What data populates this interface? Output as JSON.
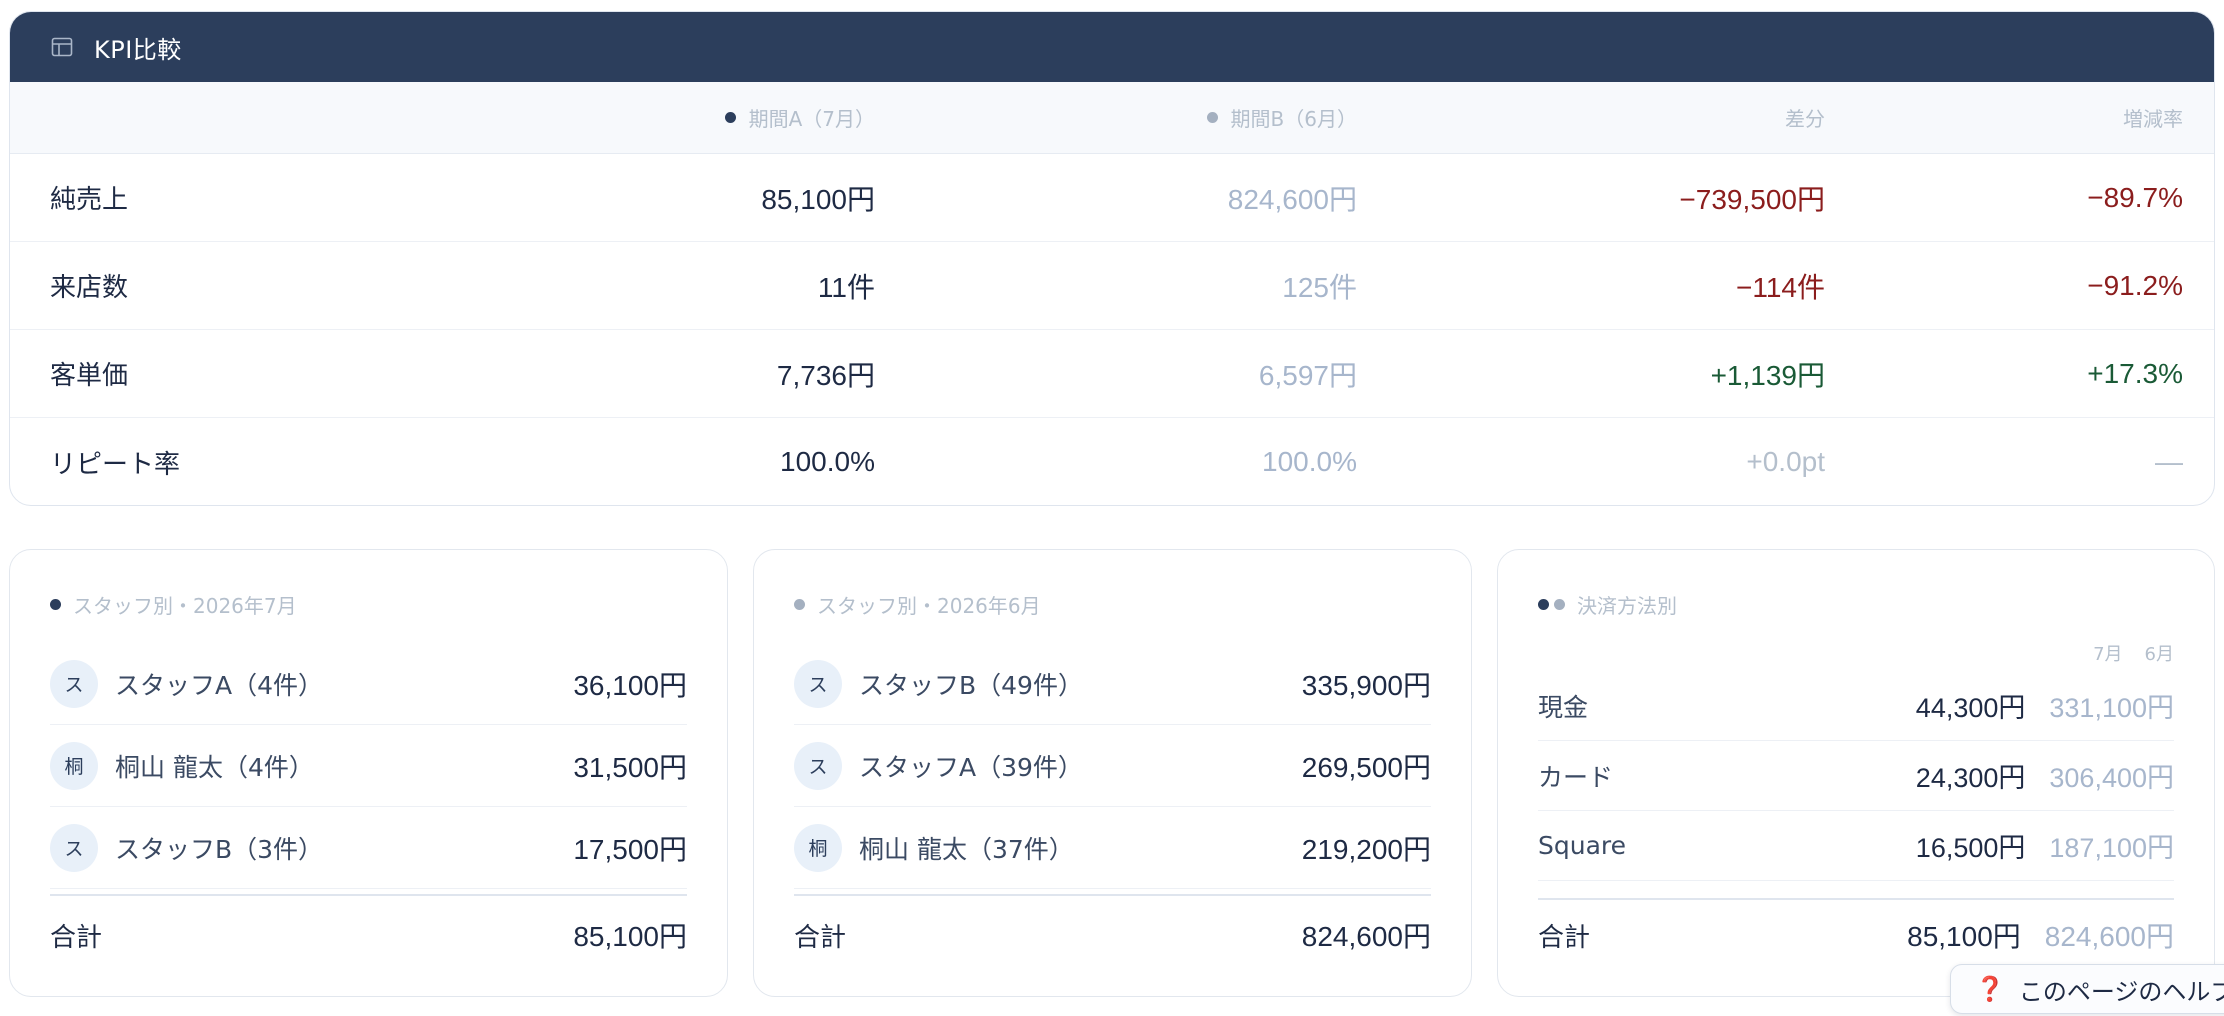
{
  "kpi": {
    "title": "KPI比較",
    "icon": "table-icon",
    "columns": {
      "a": "期間A（7月）",
      "b": "期間B（6月）",
      "diff": "差分",
      "rate": "増減率"
    },
    "rows": [
      {
        "label": "純売上",
        "a": "85,100円",
        "b": "824,600円",
        "diff": "−739,500円",
        "rate": "−89.7%",
        "trend": "negative"
      },
      {
        "label": "来店数",
        "a": "11件",
        "b": "125件",
        "diff": "−114件",
        "rate": "−91.2%",
        "trend": "negative"
      },
      {
        "label": "客単価",
        "a": "7,736円",
        "b": "6,597円",
        "diff": "+1,139円",
        "rate": "+17.3%",
        "trend": "positive"
      },
      {
        "label": "リピート率",
        "a": "100.0%",
        "b": "100.0%",
        "diff": "+0.0pt",
        "rate": "—",
        "trend": "neutral"
      }
    ]
  },
  "staff_jul": {
    "title": "スタッフ別・2026年7月",
    "rows": [
      {
        "avatar": "ス",
        "name": "スタッフA（4件）",
        "amount": "36,100円"
      },
      {
        "avatar": "桐",
        "name": "桐山 龍太（4件）",
        "amount": "31,500円"
      },
      {
        "avatar": "ス",
        "name": "スタッフB（3件）",
        "amount": "17,500円"
      }
    ],
    "total_label": "合計",
    "total": "85,100円"
  },
  "staff_jun": {
    "title": "スタッフ別・2026年6月",
    "rows": [
      {
        "avatar": "ス",
        "name": "スタッフB（49件）",
        "amount": "335,900円"
      },
      {
        "avatar": "ス",
        "name": "スタッフA（39件）",
        "amount": "269,500円"
      },
      {
        "avatar": "桐",
        "name": "桐山 龍太（37件）",
        "amount": "219,200円"
      }
    ],
    "total_label": "合計",
    "total": "824,600円"
  },
  "payment": {
    "title": "決済方法別",
    "col_a": "7月",
    "col_b": "6月",
    "rows": [
      {
        "label": "現金",
        "a": "44,300円",
        "b": "331,100円"
      },
      {
        "label": "カード",
        "a": "24,300円",
        "b": "306,400円"
      },
      {
        "label": "Square",
        "a": "16,500円",
        "b": "187,100円"
      }
    ],
    "total_label": "合計",
    "total_a": "85,100円",
    "total_b": "824,600円"
  },
  "help": {
    "icon": "question-icon",
    "glyph": "❓",
    "label": "このページのヘルプ"
  },
  "colors": {
    "header_bg": "#2c3e5c",
    "negative": "#8b1d1d",
    "positive": "#1a5a36",
    "period_b": "#a7b6cc"
  }
}
